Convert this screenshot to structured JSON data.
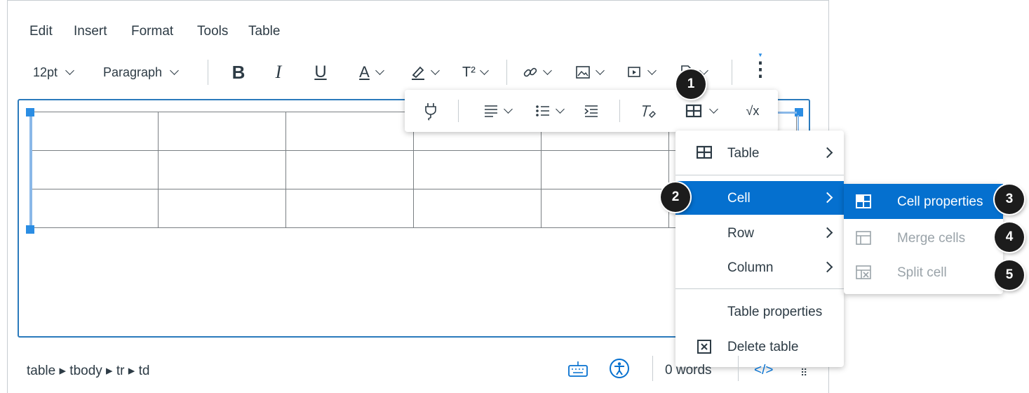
{
  "menubar": {
    "items": [
      "Edit",
      "Insert",
      "Format",
      "Tools",
      "Table"
    ]
  },
  "toolbar": {
    "font_size": "12pt",
    "block_format": "Paragraph",
    "bold": "B",
    "italic": "I",
    "underline": "U",
    "text_color": "A",
    "superscript": "T²",
    "more": "⋮"
  },
  "context_toolbar": {
    "math": "√x"
  },
  "table_menu": {
    "items": [
      {
        "label": "Table",
        "submenu": true,
        "icon": "table-icon"
      },
      {
        "label": "Cell",
        "submenu": true,
        "active": true
      },
      {
        "label": "Row",
        "submenu": true
      },
      {
        "label": "Column",
        "submenu": true
      },
      {
        "label": "Table properties",
        "submenu": false
      },
      {
        "label": "Delete table",
        "submenu": false,
        "icon": "delete-table-icon"
      }
    ]
  },
  "cell_submenu": {
    "items": [
      {
        "label": "Cell properties",
        "active": true,
        "icon": "cell-properties-icon"
      },
      {
        "label": "Merge cells",
        "disabled": true,
        "icon": "merge-cells-icon"
      },
      {
        "label": "Split cell",
        "disabled": true,
        "icon": "split-cell-icon"
      }
    ]
  },
  "badges": [
    "1",
    "2",
    "3",
    "4",
    "5"
  ],
  "statusbar": {
    "path": "table ▸ tbody ▸ tr ▸ td",
    "word_count": "0 words",
    "html_toggle": "</>"
  },
  "colors": {
    "accent": "#0570cf",
    "focus_border": "#2b7abc",
    "handle": "#2b8de3",
    "disabled_text": "#9aa3a9"
  }
}
